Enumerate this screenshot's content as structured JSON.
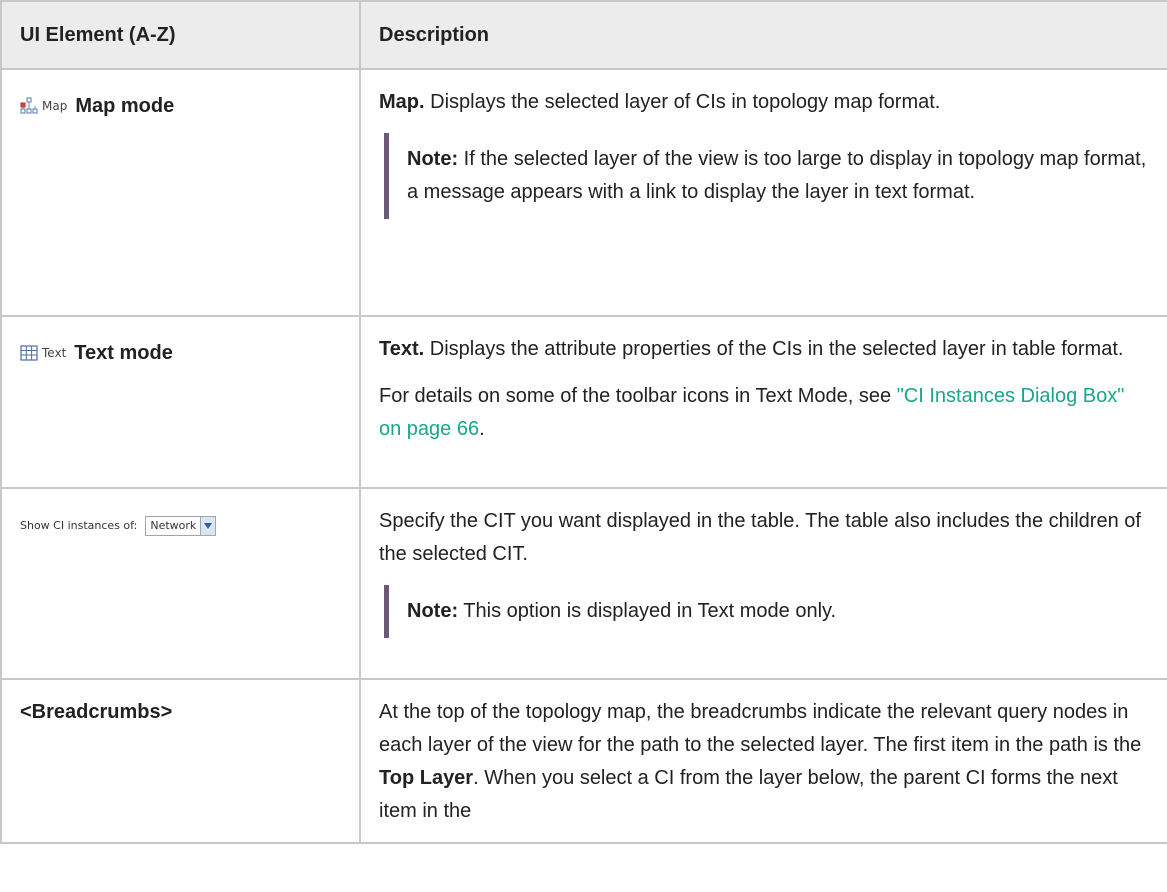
{
  "table": {
    "headers": [
      "UI Element (A-Z)",
      "Description"
    ],
    "rows": [
      {
        "icon_label": "Map",
        "element": "Map mode",
        "desc_bold": "Map.",
        "desc_text": " Displays the selected layer of CIs in topology map format.",
        "note_label": "Note:",
        "note_text": "  If the selected layer of the view is too large to display in topology map format, a message appears with a link to display the layer in text format."
      },
      {
        "icon_label": "Text",
        "element": "Text mode",
        "desc_bold": "Text.",
        "desc_text": " Displays the attribute properties of the CIs in the selected layer in table format.",
        "para2_text": "For details on some of the toolbar icons in Text Mode, see ",
        "para2_link": "\"CI Instances Dialog Box\" on page 66",
        "para2_end": "."
      },
      {
        "show_label": "Show CI instances of:",
        "combo_value": "Network",
        "desc_text": "Specify the CIT you want displayed in the table. The table also includes the children of the selected CIT.",
        "note_label": "Note:",
        "note_text": "  This option is displayed in Text mode only."
      },
      {
        "element": "<Breadcrumbs>",
        "desc_text_1": "At the top of the topology map, the breadcrumbs indicate the relevant query nodes in each layer of the view for the path to the selected layer. The first item in the path is the ",
        "desc_bold": "Top Layer",
        "desc_text_2": ". When you select a CI from the layer below, the parent CI forms the next item in the"
      }
    ]
  },
  "colors": {
    "header_bg": "#ececec",
    "border": "#c8c8c8",
    "note_bar": "#6a5a78",
    "link": "#1aa58c"
  },
  "icons": [
    "map-mode-icon",
    "text-mode-icon",
    "dropdown-arrow-icon"
  ]
}
